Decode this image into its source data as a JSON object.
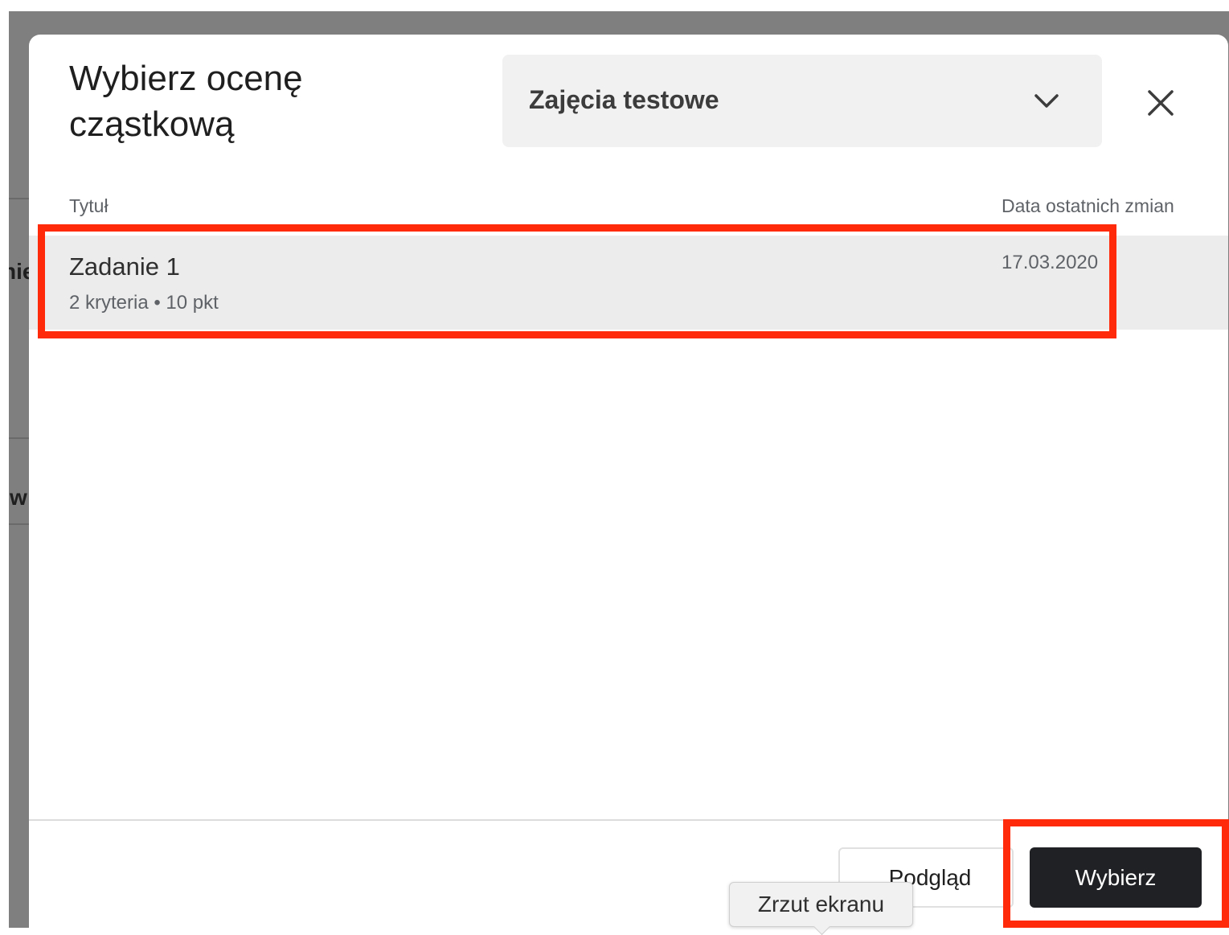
{
  "backdrop": {
    "partial_text_1": "nie",
    "partial_text_2": "w"
  },
  "dialog": {
    "title": "Wybierz ocenę cząstkową",
    "class_select": {
      "selected_value": "Zajęcia testowe",
      "icon": "chevron-down-icon"
    },
    "close_icon": "close-icon"
  },
  "table": {
    "columns": {
      "title": "Tytuł",
      "date": "Data ostatnich zmian"
    },
    "rows": [
      {
        "title": "Zadanie 1",
        "meta": "2 kryteria • 10 pkt",
        "date": "17.03.2020",
        "selected": true
      }
    ]
  },
  "footer": {
    "preview_label": "Podgląd",
    "select_label": "Wybierz"
  },
  "tooltip": {
    "text": "Zrzut ekranu"
  },
  "colors": {
    "highlight": "#ff2a0a",
    "primary_button": "#202124",
    "selected_row": "#ececec",
    "overlay": "#7f7f7f"
  }
}
